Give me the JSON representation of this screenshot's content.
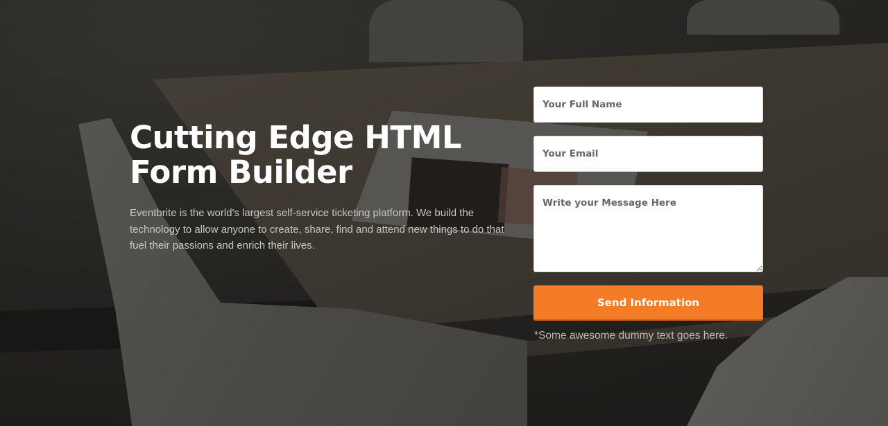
{
  "hero": {
    "title_line1": "Cutting Edge HTML",
    "title_line2": "Form Builder",
    "description": "Eventbrite is the world's largest self-service ticketing platform. We build the technology to allow anyone to create, share, find and attend new things to do that fuel their passions and enrich their lives."
  },
  "form": {
    "name_placeholder": "Your Full Name",
    "name_value": "",
    "email_placeholder": "Your Email",
    "email_value": "",
    "message_placeholder": "Write your Message Here",
    "message_value": "",
    "submit_label": "Send Information",
    "footnote": "*Some awesome dummy text goes here."
  },
  "colors": {
    "accent": "#f47c27",
    "title_text": "#ffffff",
    "body_text": "#c9c6c1"
  }
}
